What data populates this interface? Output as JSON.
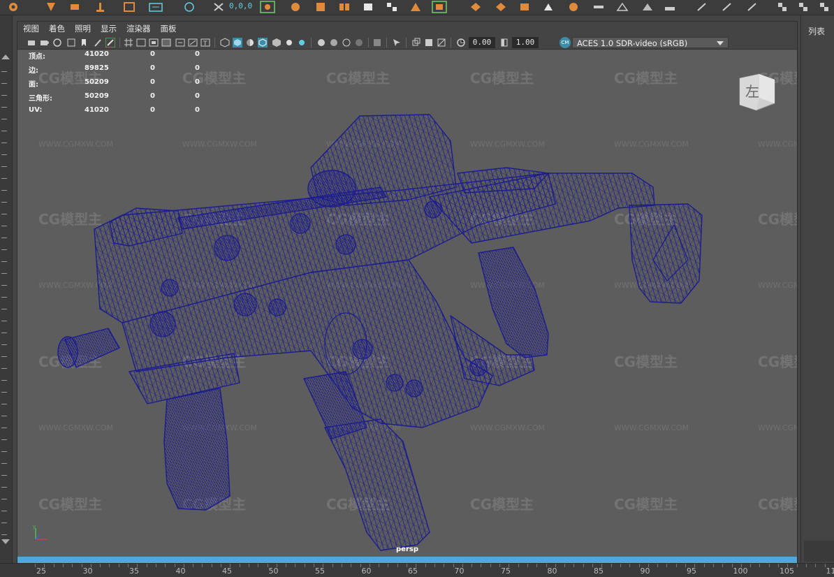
{
  "shelf": {
    "coord_text": "0,0,0",
    "icons": [
      "snap-icon",
      "paint-icon",
      "move-icon",
      "scale-icon",
      "grid-icon",
      "camera-icon",
      "xform-icon",
      "select-icon",
      "lasso-icon",
      "cube-icon",
      "cut-icon",
      "split-icon",
      "fill-icon",
      "merge-icon",
      "box-icon",
      "deform-icon",
      "sphere-icon",
      "cone-icon",
      "flag-icon",
      "triangle-icon",
      "play-icon",
      "flat-icon",
      "arrow-icon",
      "check-icon",
      "grid2-icon"
    ]
  },
  "panel_menu": [
    "视图",
    "着色",
    "照明",
    "显示",
    "渲染器",
    "面板"
  ],
  "toolbar": {
    "gamma": "0.00",
    "exposure": "1.00",
    "color_space": "ACES 1.0 SDR-video (sRGB)",
    "color_space_icon": "CM"
  },
  "hud": {
    "rows": [
      {
        "label": "顶点:",
        "a": "41020",
        "b": "0",
        "c": "0"
      },
      {
        "label": "边:",
        "a": "89825",
        "b": "0",
        "c": "0"
      },
      {
        "label": "面:",
        "a": "50209",
        "b": "0",
        "c": "0"
      },
      {
        "label": "三角形:",
        "a": "50209",
        "b": "0",
        "c": "0"
      },
      {
        "label": "UV:",
        "a": "41020",
        "b": "0",
        "c": "0"
      }
    ]
  },
  "viewcube": {
    "face_label": "左"
  },
  "camera_label": "persp",
  "right_panel": {
    "title": "列表"
  },
  "watermarks": {
    "brand": "CG模型主",
    "url": "WWW.CGMXW.COM"
  },
  "ruler": [
    "25",
    "30",
    "35",
    "40",
    "45",
    "50",
    "55",
    "60",
    "65",
    "70",
    "75",
    "80",
    "85",
    "90",
    "95",
    "100",
    "105",
    "11"
  ],
  "colors": {
    "wire": "#1c1c8f",
    "viewport_bg": "#5d5d5d",
    "timebar": "#54a6d6"
  }
}
